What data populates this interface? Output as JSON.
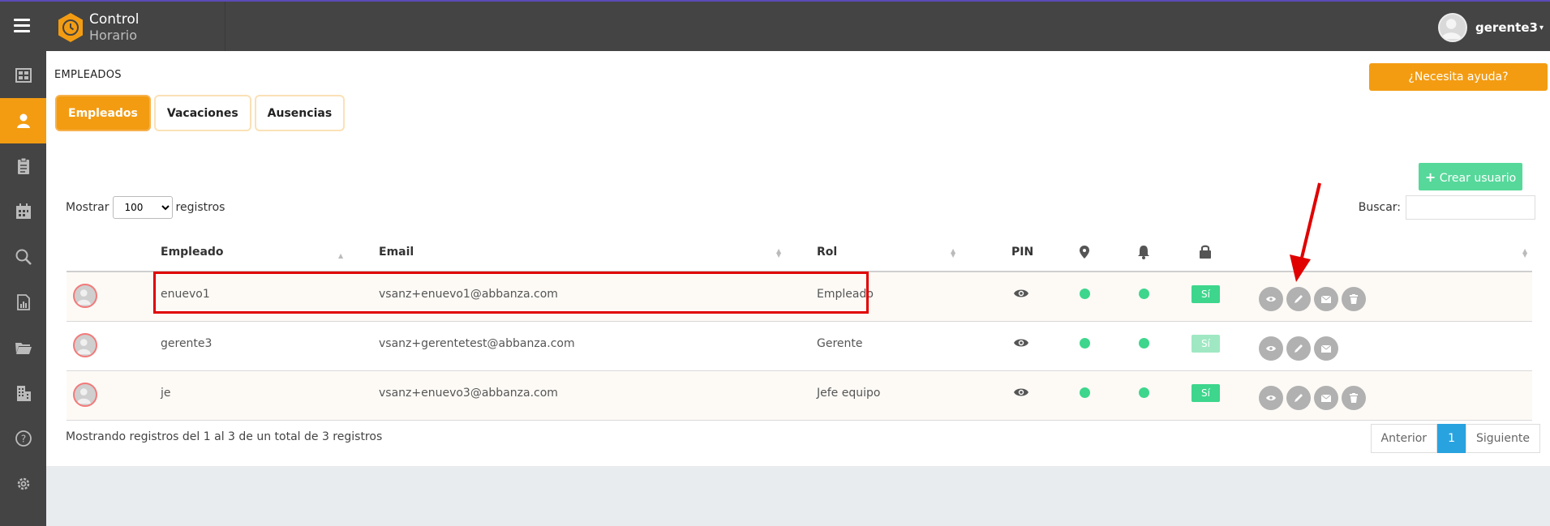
{
  "app": {
    "brand_line1": "Control",
    "brand_line2": "Horario"
  },
  "user": {
    "name": "gerente3",
    "caret": "▾"
  },
  "sidebar": {
    "items": [
      {
        "icon": "dashboard-icon",
        "active": false
      },
      {
        "icon": "user-icon",
        "active": true
      },
      {
        "icon": "clipboard-icon",
        "active": false
      },
      {
        "icon": "calendar-icon",
        "active": false
      },
      {
        "icon": "search-icon",
        "active": false
      },
      {
        "icon": "report-icon",
        "active": false
      },
      {
        "icon": "folder-icon",
        "active": false
      },
      {
        "icon": "building-icon",
        "active": false
      },
      {
        "icon": "help-icon",
        "active": false
      },
      {
        "icon": "gear-icon",
        "active": false
      }
    ]
  },
  "page": {
    "title": "EMPLEADOS",
    "help_label": "¿Necesita ayuda?"
  },
  "tabs": [
    {
      "label": "Empleados",
      "active": true
    },
    {
      "label": "Vacaciones",
      "active": false
    },
    {
      "label": "Ausencias",
      "active": false
    }
  ],
  "toolbar": {
    "create_label": "Crear usuario",
    "create_plus": "+",
    "show_label": "Mostrar",
    "show_value": "100",
    "records_label": "registros",
    "search_label": "Buscar:"
  },
  "table": {
    "headers": {
      "employee": "Empleado",
      "email": "Email",
      "role": "Rol",
      "pin": "PIN"
    },
    "rows": [
      {
        "name": "enuevo1",
        "email": "vsanz+enuevo1@abbanza.com",
        "role": "Empleado",
        "flag": "Sí",
        "can_delete": true
      },
      {
        "name": "gerente3",
        "email": "vsanz+gerentetest@abbanza.com",
        "role": "Gerente",
        "flag": "Sí",
        "can_delete": false
      },
      {
        "name": "je",
        "email": "vsanz+enuevo3@abbanza.com",
        "role": "Jefe equipo",
        "flag": "Sí",
        "can_delete": true
      }
    ]
  },
  "footer": {
    "info": "Mostrando registros del 1 al 3 de un total de 3 registros",
    "prev": "Anterior",
    "page": "1",
    "next": "Siguiente"
  },
  "colors": {
    "accent": "#f39c12",
    "success": "#3dd68c",
    "topbar": "#444444",
    "highlight": "#e00000",
    "page_active": "#29a3e0"
  }
}
